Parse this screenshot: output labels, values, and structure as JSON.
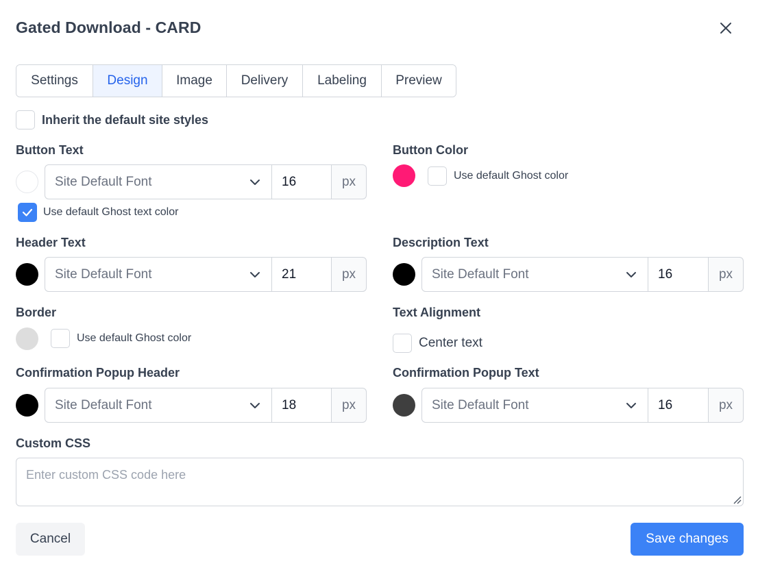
{
  "dialog": {
    "title": "Gated Download - CARD",
    "close_icon": "close-icon"
  },
  "tabs": [
    {
      "label": "Settings",
      "active": false
    },
    {
      "label": "Design",
      "active": true
    },
    {
      "label": "Image",
      "active": false
    },
    {
      "label": "Delivery",
      "active": false
    },
    {
      "label": "Labeling",
      "active": false
    },
    {
      "label": "Preview",
      "active": false
    }
  ],
  "inherit": {
    "label": "Inherit the default site styles",
    "checked": false
  },
  "button_text": {
    "label": "Button Text",
    "color": "#ffffff",
    "font": "Site Default Font",
    "size": "16",
    "unit": "px",
    "default_color_label": "Use default Ghost text color",
    "default_color_checked": true
  },
  "button_color": {
    "label": "Button Color",
    "color": "#ff1a75",
    "default_color_label": "Use default Ghost color",
    "default_color_checked": false
  },
  "header_text": {
    "label": "Header Text",
    "color": "#000000",
    "font": "Site Default Font",
    "size": "21",
    "unit": "px"
  },
  "description_text": {
    "label": "Description Text",
    "color": "#000000",
    "font": "Site Default Font",
    "size": "16",
    "unit": "px"
  },
  "border": {
    "label": "Border",
    "color": "#dddddd",
    "default_color_label": "Use default Ghost color",
    "default_color_checked": false
  },
  "text_alignment": {
    "label": "Text Alignment",
    "center_label": "Center text",
    "center_checked": false
  },
  "confirm_header": {
    "label": "Confirmation Popup Header",
    "color": "#000000",
    "font": "Site Default Font",
    "size": "18",
    "unit": "px"
  },
  "confirm_text": {
    "label": "Confirmation Popup Text",
    "color": "#3f3f3f",
    "font": "Site Default Font",
    "size": "16",
    "unit": "px"
  },
  "custom_css": {
    "label": "Custom CSS",
    "placeholder": "Enter custom CSS code here",
    "value": ""
  },
  "actions": {
    "cancel_label": "Cancel",
    "save_label": "Save changes"
  },
  "colors": {
    "accent": "#3b82f6",
    "tab_active_bg": "#eef4ff",
    "border": "#d1d5db"
  }
}
